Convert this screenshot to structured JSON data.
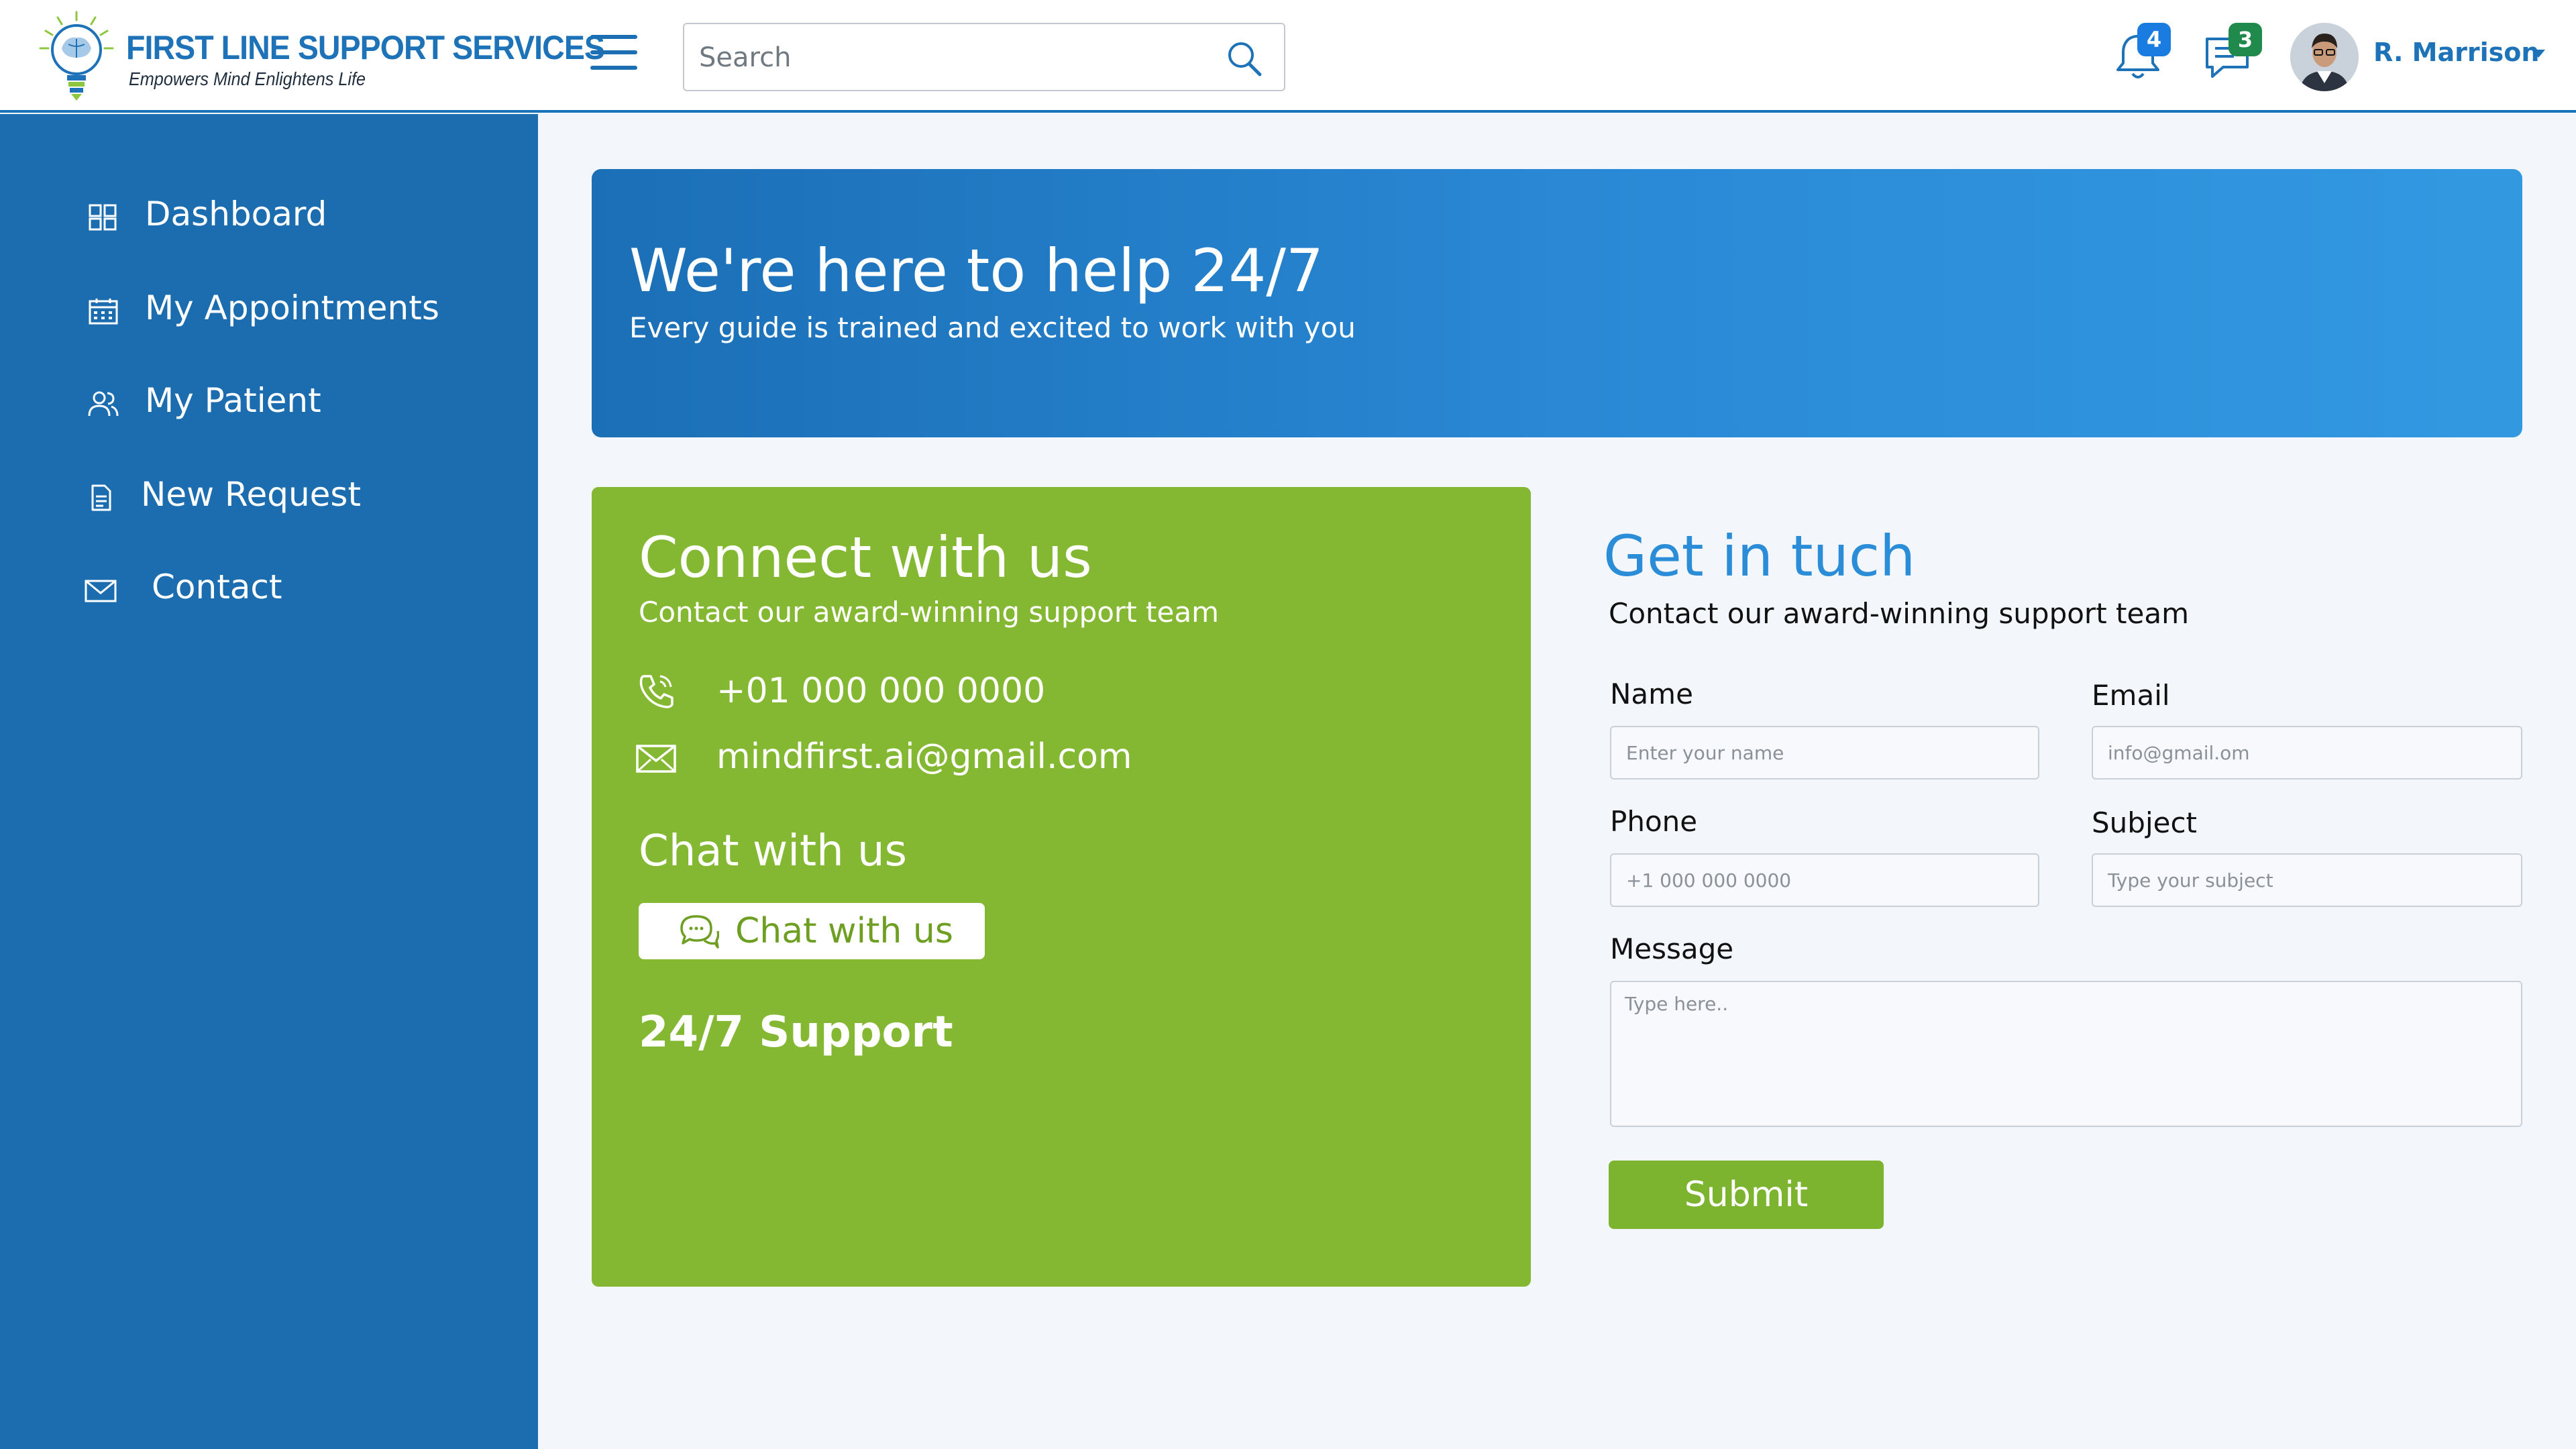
{
  "brand": {
    "title": "FIRST LINE SUPPORT SERVICES",
    "tagline": "Empowers Mind Enlightens Life",
    "logo_icon": "lightbulb-brain-icon"
  },
  "header": {
    "search_placeholder": "Search",
    "notifications_count": "4",
    "messages_count": "3",
    "user_name": "R. Marrison"
  },
  "sidebar": {
    "items": [
      {
        "label": "Dashboard",
        "icon": "dashboard-grid-icon"
      },
      {
        "label": "My Appointments",
        "icon": "calendar-icon"
      },
      {
        "label": "My Patient",
        "icon": "users-icon"
      },
      {
        "label": "New Request",
        "icon": "document-icon"
      },
      {
        "label": "Contact",
        "icon": "envelope-icon"
      }
    ]
  },
  "hero": {
    "title": "We're here to help 24/7",
    "subtitle": "Every guide is trained and excited to work with you"
  },
  "connect": {
    "title": "Connect with us",
    "subtitle": "Contact our award-winning support team",
    "phone": "+01 000 000 0000",
    "email": "mindfirst.ai@gmail.com",
    "chat_heading": "Chat with us",
    "chat_button": "Chat with us",
    "support": "24/7 Support"
  },
  "form": {
    "title": "Get in tuch",
    "subtitle": "Contact our award-winning support team",
    "name_label": "Name",
    "name_placeholder": "Enter your name",
    "email_label": "Email",
    "email_placeholder": "info@gmail.om",
    "phone_label": "Phone",
    "phone_placeholder": "+1 000 000 0000",
    "subject_label": "Subject",
    "subject_placeholder": "Type your subject",
    "message_label": "Message",
    "message_placeholder": "Type here..",
    "submit_label": "Submit"
  },
  "colors": {
    "primary": "#1b6db0",
    "accent_green": "#84b832",
    "heading_blue": "#2b8dd8",
    "badge_blue": "#1a7ce0",
    "badge_green": "#1f8a4c"
  }
}
